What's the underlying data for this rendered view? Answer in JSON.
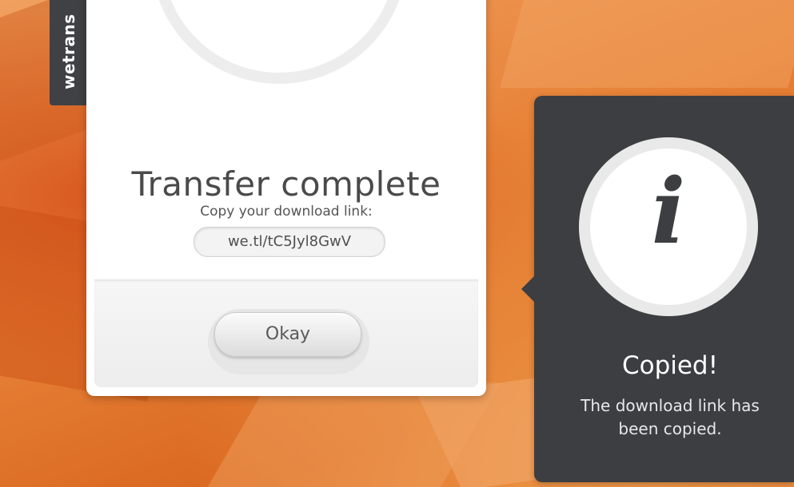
{
  "brand": {
    "tab_text": "wetrans"
  },
  "dialog": {
    "title": "Transfer complete",
    "subtitle": "Copy your download link:",
    "link": "we.tl/tC5Jyl8GwV",
    "ok_label": "Okay"
  },
  "tooltip": {
    "icon": "info-icon",
    "icon_glyph": "i",
    "title": "Copied!",
    "message": "The download link has been copied."
  },
  "colors": {
    "accent_dark": "#3d3e42",
    "background": "#e98a3e"
  }
}
